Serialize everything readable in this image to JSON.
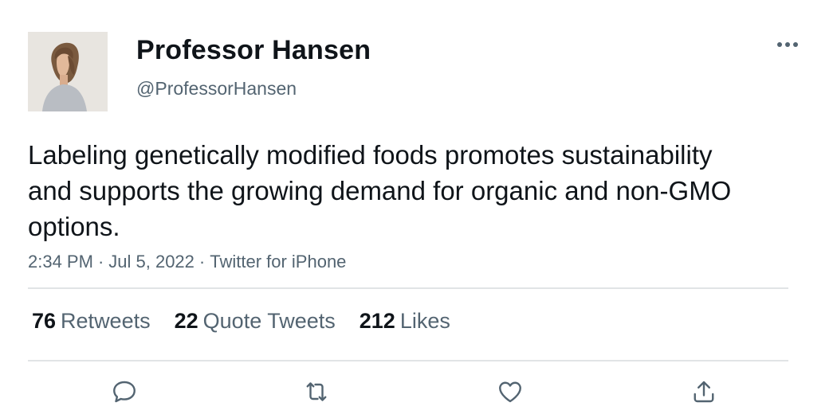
{
  "user": {
    "name": "Professor Hansen",
    "handle": "@ProfessorHansen"
  },
  "tweet": {
    "text": "Labeling genetically modified foods promotes sustainability and supports the growing demand for organic and non-GMO options.",
    "time": "2:34 PM",
    "date": "Jul 5, 2022",
    "source": "Twitter for iPhone",
    "separator": "·"
  },
  "stats": {
    "retweets": {
      "count": "76",
      "label": "Retweets"
    },
    "quote_tweets": {
      "count": "22",
      "label": "Quote Tweets"
    },
    "likes": {
      "count": "212",
      "label": "Likes"
    }
  },
  "colors": {
    "text": "#0f1419",
    "secondary": "#536471",
    "divider": "#e1e4e6",
    "icon": "#536471"
  },
  "icons": {
    "more": "more-horizontal-icon",
    "reply": "reply-bubble-icon",
    "retweet": "retweet-arrows-icon",
    "like": "heart-icon",
    "share": "share-upload-icon"
  }
}
